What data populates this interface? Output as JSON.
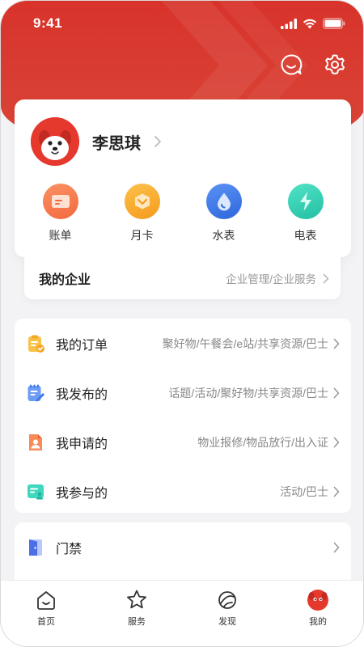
{
  "status_bar": {
    "time": "9:41"
  },
  "header": {
    "actions": [
      {
        "icon": "chat-bubble-icon"
      },
      {
        "icon": "gear-icon"
      }
    ]
  },
  "profile": {
    "name": "李思琪",
    "avatar_icon": "dog-mascot-avatar",
    "quick_actions": [
      {
        "label": "账单",
        "icon": "bill-icon",
        "color": "#f5754a"
      },
      {
        "label": "月卡",
        "icon": "month-card-icon",
        "color": "#f9a92a"
      },
      {
        "label": "水表",
        "icon": "water-drop-icon",
        "color": "#3c78e8"
      },
      {
        "label": "电表",
        "icon": "lightning-icon",
        "color": "#35d1b6"
      }
    ]
  },
  "company": {
    "title": "我的企业",
    "links": "企业管理/企业服务"
  },
  "menu": [
    {
      "title": "我的订单",
      "sub": "聚好物/午餐会/e站/共享资源/巴士",
      "icon": "clipboard-check-icon"
    },
    {
      "title": "我发布的",
      "sub": "话题/活动/聚好物/共享资源/巴士",
      "icon": "edit-note-icon"
    },
    {
      "title": "我申请的",
      "sub": "物业报修/物品放行/出入证",
      "icon": "application-person-icon"
    },
    {
      "title": "我参与的",
      "sub": "活动/巴士",
      "icon": "id-card-icon"
    }
  ],
  "access": {
    "title": "门禁",
    "icon": "door-icon"
  },
  "tabbar": [
    {
      "label": "首页",
      "icon": "home-icon"
    },
    {
      "label": "服务",
      "icon": "star-icon"
    },
    {
      "label": "发现",
      "icon": "planet-icon"
    },
    {
      "label": "我的",
      "icon": "mascot-face-icon",
      "active": true
    }
  ],
  "colors": {
    "brand_red": "#d8332b",
    "accent_blue": "#3c78e8"
  }
}
